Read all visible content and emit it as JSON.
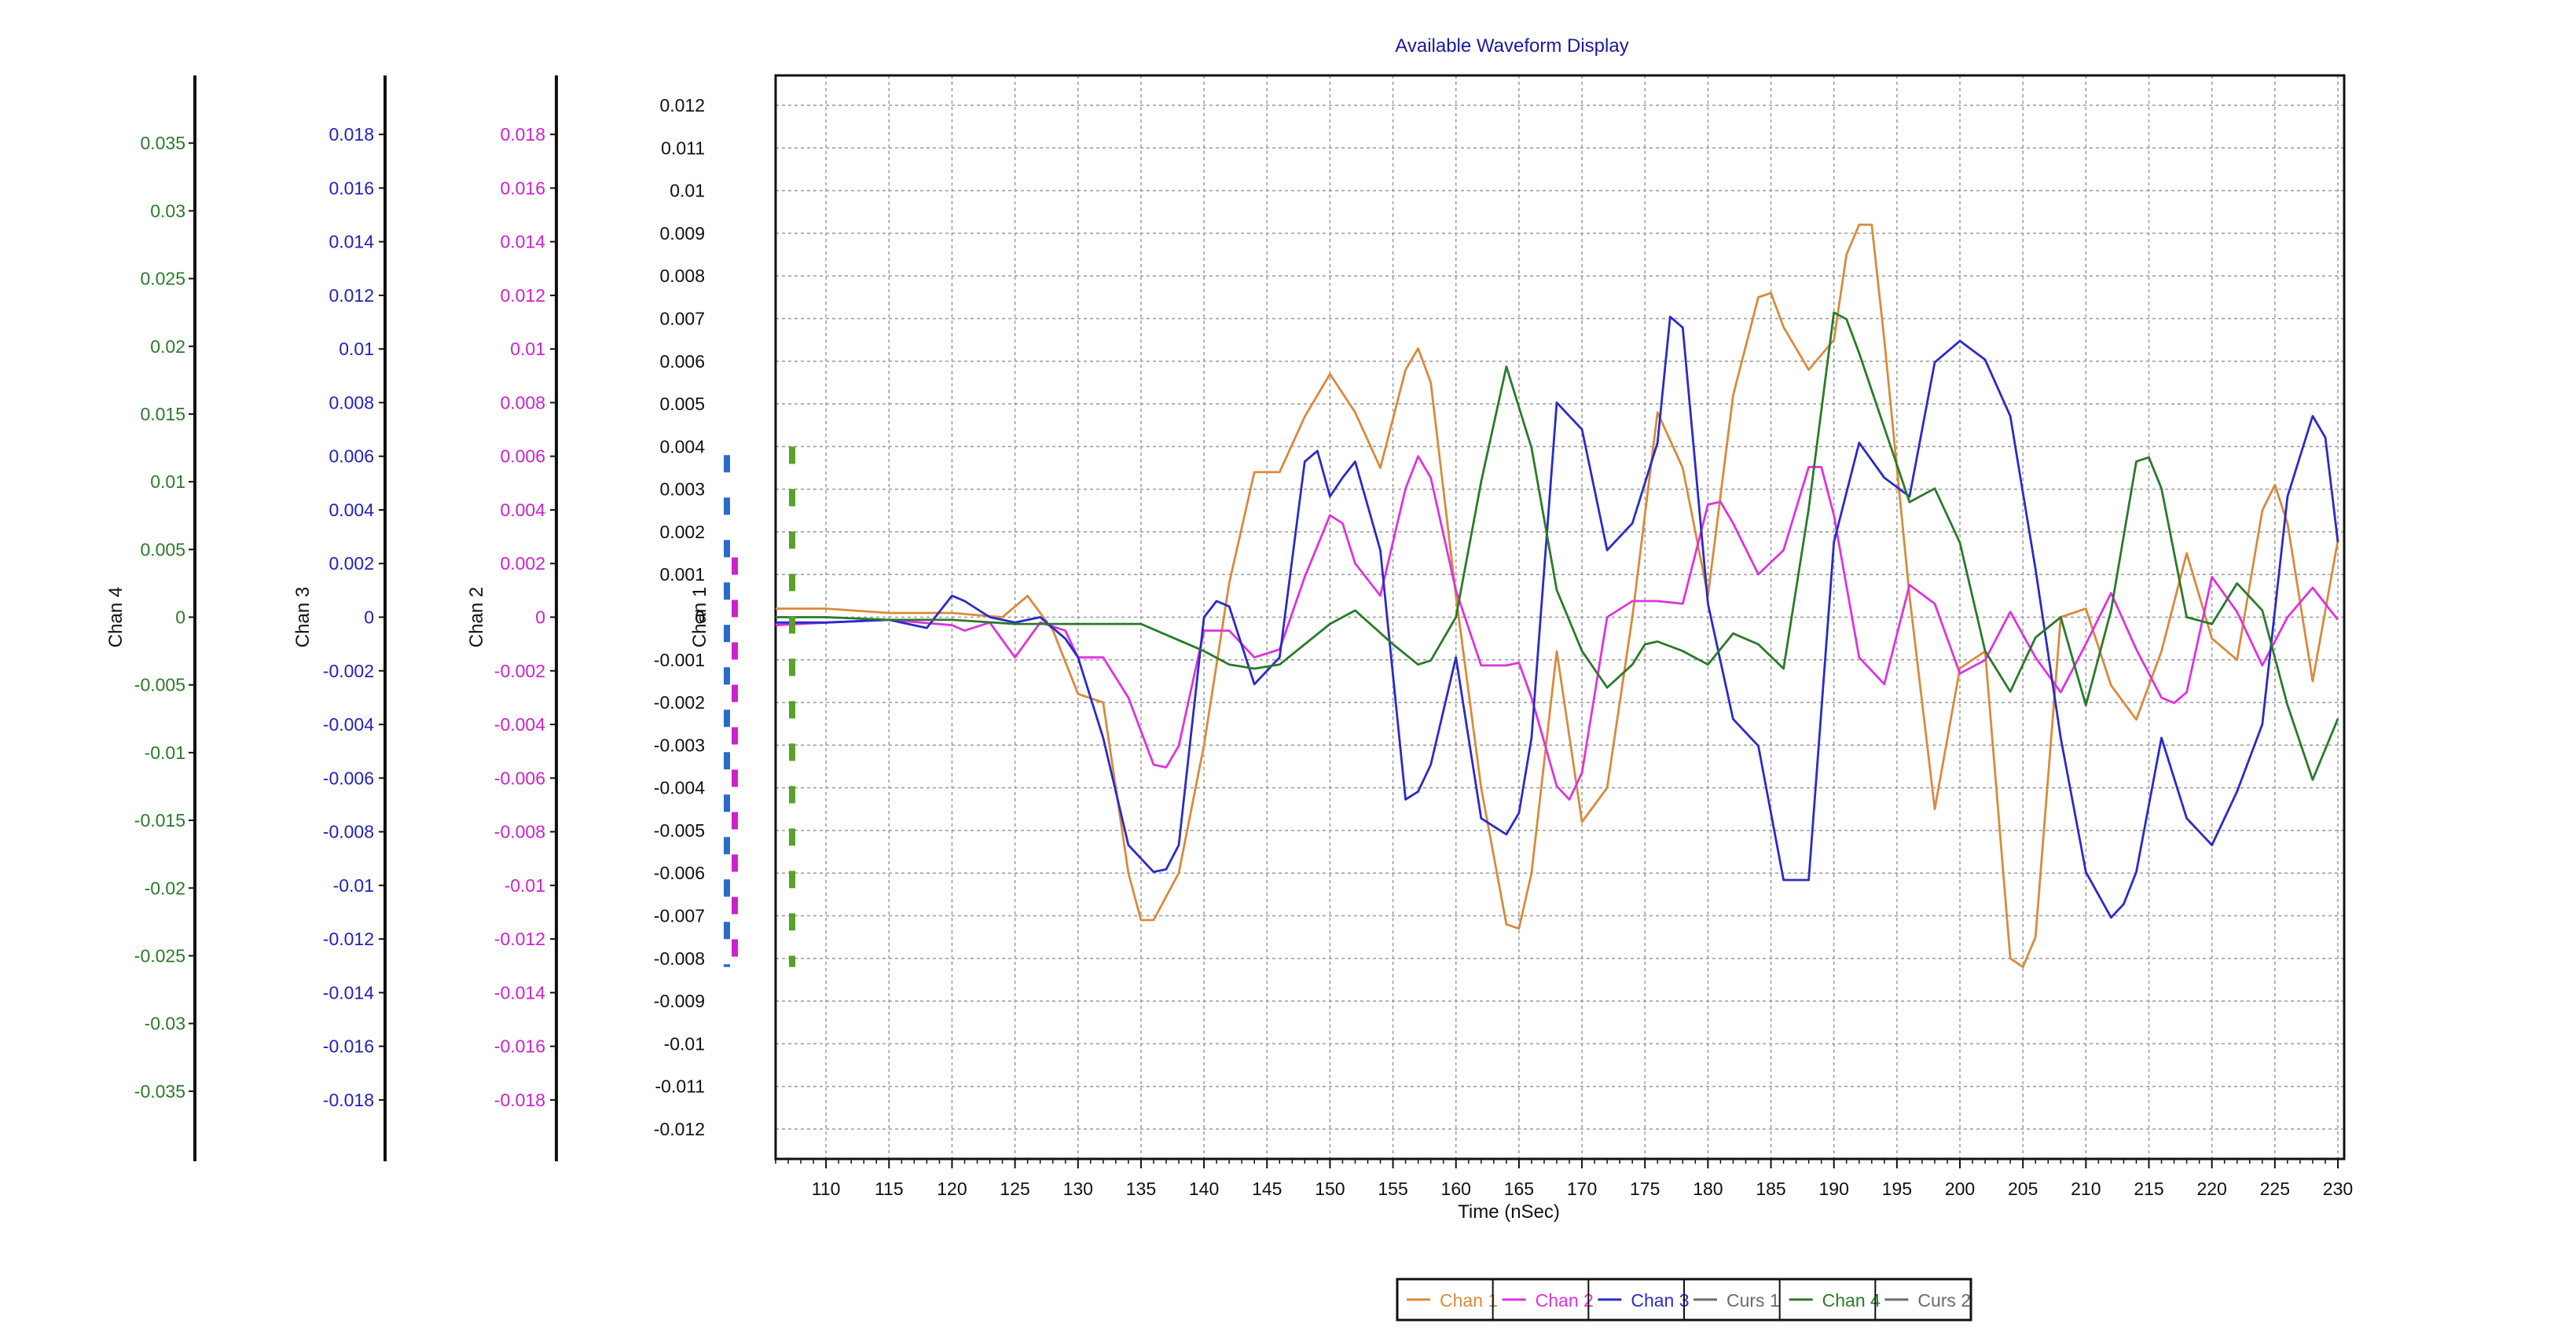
{
  "chart_data": {
    "type": "line",
    "title": "Available Waveform Display",
    "xlabel": "Time (nSec)",
    "xlim": [
      106,
      230.5
    ],
    "xticks": [
      110,
      115,
      120,
      125,
      130,
      135,
      140,
      145,
      150,
      155,
      160,
      165,
      170,
      175,
      180,
      185,
      190,
      195,
      200,
      205,
      210,
      215,
      220,
      225,
      230
    ],
    "xtick_labels": [
      "110",
      "115",
      "120",
      "125",
      "130",
      "135",
      "140",
      "145",
      "150",
      "155",
      "160",
      "165",
      "170",
      "175",
      "180",
      "185",
      "190",
      "195",
      "200",
      "205",
      "210",
      "215",
      "220",
      "225",
      "230"
    ],
    "grid": true,
    "legend_placement": "bottom-center",
    "y_axes": [
      {
        "id": "chan1",
        "label": "Chan 1",
        "color": "#111111",
        "ylim": [
          -0.0127,
          0.0127
        ],
        "ticks": [
          0.012,
          0.011,
          0.01,
          0.009,
          0.008,
          0.007,
          0.006,
          0.005,
          0.004,
          0.003,
          0.002,
          0.001,
          0,
          -0.001,
          -0.002,
          -0.003,
          -0.004,
          -0.005,
          -0.006,
          -0.007,
          -0.008,
          -0.009,
          -0.01,
          -0.011,
          -0.012
        ],
        "tick_labels": [
          "0.012",
          "0.011",
          "0.01",
          "0.009",
          "0.008",
          "0.007",
          "0.006",
          "0.005",
          "0.004",
          "0.003",
          "0.002",
          "0.001",
          "0",
          "-0.001",
          "-0.002",
          "-0.003",
          "-0.004",
          "-0.005",
          "-0.006",
          "-0.007",
          "-0.008",
          "-0.009",
          "-0.01",
          "-0.011",
          "-0.012"
        ]
      },
      {
        "id": "chan2",
        "label": "Chan 2",
        "color": "#cc22cc",
        "ylim": [
          -0.0202,
          0.0202
        ],
        "ticks": [
          0.018,
          0.016,
          0.014,
          0.012,
          0.01,
          0.008,
          0.006,
          0.004,
          0.002,
          0,
          -0.002,
          -0.004,
          -0.006,
          -0.008,
          -0.01,
          -0.012,
          -0.014,
          -0.016,
          -0.018
        ],
        "tick_labels": [
          "0.018",
          "0.016",
          "0.014",
          "0.012",
          "0.01",
          "0.008",
          "0.006",
          "0.004",
          "0.002",
          "0",
          "-0.002",
          "-0.004",
          "-0.006",
          "-0.008",
          "-0.01",
          "-0.012",
          "-0.014",
          "-0.016",
          "-0.018"
        ]
      },
      {
        "id": "chan3",
        "label": "Chan 3",
        "color": "#2222bb",
        "ylim": [
          -0.0202,
          0.0202
        ],
        "ticks": [
          0.018,
          0.016,
          0.014,
          0.012,
          0.01,
          0.008,
          0.006,
          0.004,
          0.002,
          0,
          -0.002,
          -0.004,
          -0.006,
          -0.008,
          -0.01,
          -0.012,
          -0.014,
          -0.016,
          -0.018
        ],
        "tick_labels": [
          "0.018",
          "0.016",
          "0.014",
          "0.012",
          "0.01",
          "0.008",
          "0.006",
          "0.004",
          "0.002",
          "0",
          "-0.002",
          "-0.004",
          "-0.006",
          "-0.008",
          "-0.01",
          "-0.012",
          "-0.014",
          "-0.016",
          "-0.018"
        ]
      },
      {
        "id": "chan4",
        "label": "Chan 4",
        "color": "#2a7a2a",
        "ylim": [
          -0.04,
          0.04
        ],
        "ticks": [
          0.035,
          0.03,
          0.025,
          0.02,
          0.015,
          0.01,
          0.005,
          0,
          -0.005,
          -0.01,
          -0.015,
          -0.02,
          -0.025,
          -0.03,
          -0.035
        ],
        "tick_labels": [
          "0.035",
          "0.03",
          "0.025",
          "0.02",
          "0.015",
          "0.01",
          "0.005",
          "0",
          "-0.005",
          "-0.01",
          "-0.015",
          "-0.02",
          "-0.025",
          "-0.03",
          "-0.035"
        ]
      }
    ],
    "series": [
      {
        "name": "Chan 1",
        "axis": "chan1",
        "color": "#d98a3c",
        "x": [
          106,
          110,
          115,
          120,
          124,
          126,
          128,
          130,
          132,
          134,
          135,
          136,
          138,
          140,
          142,
          144,
          146,
          148,
          150,
          152,
          154,
          156,
          157,
          158,
          160,
          162,
          164,
          165,
          166,
          168,
          170,
          172,
          174,
          176,
          178,
          180,
          182,
          184,
          185,
          186,
          188,
          190,
          191,
          192,
          193,
          194,
          196,
          198,
          200,
          202,
          204,
          205,
          206,
          208,
          210,
          212,
          214,
          216,
          218,
          220,
          222,
          224,
          225,
          226,
          228,
          230
        ],
        "y": [
          0.0002,
          0.0002,
          0.0001,
          0.0001,
          0.0,
          0.0005,
          -0.0003,
          -0.0018,
          -0.002,
          -0.006,
          -0.0071,
          -0.0071,
          -0.006,
          -0.003,
          0.0008,
          0.0034,
          0.0034,
          0.0047,
          0.0057,
          0.0048,
          0.0035,
          0.0058,
          0.0063,
          0.0055,
          0.0005,
          -0.004,
          -0.0072,
          -0.0073,
          -0.006,
          -0.0008,
          -0.0048,
          -0.004,
          0.0,
          0.0048,
          0.0035,
          0.0005,
          0.0052,
          0.0075,
          0.0076,
          0.0068,
          0.0058,
          0.0065,
          0.0085,
          0.0092,
          0.0092,
          0.0065,
          0.0005,
          -0.0045,
          -0.0012,
          -0.0008,
          -0.008,
          -0.0082,
          -0.0075,
          0.0,
          0.0002,
          -0.0016,
          -0.0024,
          -0.0008,
          0.0015,
          -0.0005,
          -0.001,
          0.0025,
          0.0031,
          0.0022,
          -0.0015,
          0.0018
        ]
      },
      {
        "name": "Chan 2",
        "axis": "chan2",
        "color": "#dd33dd",
        "x": [
          106,
          110,
          115,
          120,
          121,
          123,
          125,
          127,
          129,
          130,
          132,
          134,
          136,
          137,
          138,
          140,
          142,
          144,
          146,
          148,
          150,
          151,
          152,
          154,
          156,
          157,
          158,
          160,
          162,
          164,
          165,
          166,
          168,
          169,
          170,
          172,
          174,
          176,
          178,
          180,
          181,
          182,
          184,
          186,
          188,
          189,
          190,
          192,
          194,
          196,
          198,
          200,
          202,
          204,
          206,
          208,
          210,
          212,
          214,
          216,
          217,
          218,
          220,
          222,
          224,
          226,
          228,
          230
        ],
        "y": [
          -0.0003,
          -0.0002,
          -0.0001,
          -0.0003,
          -0.0005,
          -0.0002,
          -0.0015,
          -0.0002,
          -0.0005,
          -0.0015,
          -0.0015,
          -0.003,
          -0.0055,
          -0.0056,
          -0.0048,
          -0.0005,
          -0.0005,
          -0.0015,
          -0.0012,
          0.0015,
          0.0038,
          0.0035,
          0.002,
          0.0008,
          0.0048,
          0.006,
          0.0052,
          0.001,
          -0.0018,
          -0.0018,
          -0.0017,
          -0.003,
          -0.0063,
          -0.0068,
          -0.0058,
          0.0,
          0.0006,
          0.0006,
          0.0005,
          0.0042,
          0.0043,
          0.0035,
          0.0016,
          0.0025,
          0.0056,
          0.0056,
          0.0038,
          -0.0015,
          -0.0025,
          0.0012,
          0.0005,
          -0.0021,
          -0.0016,
          0.0002,
          -0.0015,
          -0.0028,
          -0.001,
          0.0009,
          -0.0012,
          -0.003,
          -0.0032,
          -0.0028,
          0.0015,
          0.0002,
          -0.0018,
          0.0,
          0.0011,
          -0.0001
        ]
      },
      {
        "name": "Chan 3",
        "axis": "chan3",
        "color": "#2a2acc",
        "x": [
          106,
          110,
          115,
          118,
          120,
          121,
          123,
          125,
          127,
          128,
          129,
          130,
          132,
          134,
          136,
          137,
          138,
          140,
          141,
          142,
          144,
          146,
          148,
          149,
          150,
          151,
          152,
          154,
          156,
          157,
          158,
          160,
          162,
          164,
          165,
          166,
          168,
          170,
          172,
          174,
          176,
          177,
          178,
          180,
          182,
          184,
          186,
          188,
          190,
          192,
          194,
          196,
          198,
          200,
          202,
          204,
          206,
          208,
          210,
          212,
          213,
          214,
          216,
          218,
          220,
          222,
          224,
          226,
          228,
          229,
          230
        ],
        "y": [
          -0.0002,
          -0.0002,
          -0.0001,
          -0.0004,
          0.0008,
          0.0006,
          0.0,
          -0.0002,
          0.0,
          -0.0004,
          -0.0008,
          -0.0015,
          -0.0045,
          -0.0085,
          -0.0095,
          -0.0094,
          -0.0085,
          0.0,
          0.0006,
          0.0004,
          -0.0025,
          -0.0015,
          0.0058,
          0.0062,
          0.0045,
          0.0052,
          0.0058,
          0.0025,
          -0.0068,
          -0.0065,
          -0.0055,
          -0.0015,
          -0.0075,
          -0.0081,
          -0.0073,
          -0.0045,
          0.008,
          0.007,
          0.0025,
          0.0035,
          0.0065,
          0.0112,
          0.0108,
          0.0005,
          -0.0038,
          -0.0048,
          -0.0098,
          -0.0098,
          0.0028,
          0.0065,
          0.0052,
          0.0045,
          0.0095,
          0.0103,
          0.0096,
          0.0075,
          0.0018,
          -0.0045,
          -0.0095,
          -0.0112,
          -0.0107,
          -0.0095,
          -0.0045,
          -0.0075,
          -0.0085,
          -0.0065,
          -0.004,
          0.0045,
          0.0075,
          0.0067,
          0.0028
        ]
      },
      {
        "name": "Curs 1",
        "axis": "chan1",
        "color": "#6b6b6b",
        "x": [],
        "y": []
      },
      {
        "name": "Chan 4",
        "axis": "chan4",
        "color": "#2a7a2a",
        "x": [
          106,
          110,
          115,
          120,
          125,
          130,
          135,
          140,
          142,
          144,
          146,
          148,
          150,
          152,
          155,
          157,
          158,
          160,
          162,
          164,
          166,
          168,
          170,
          172,
          174,
          175,
          176,
          178,
          180,
          182,
          184,
          186,
          188,
          190,
          191,
          192,
          194,
          196,
          198,
          200,
          202,
          204,
          206,
          208,
          210,
          212,
          214,
          215,
          216,
          218,
          220,
          222,
          224,
          226,
          228,
          230
        ],
        "y": [
          0.0,
          0.0,
          -0.0002,
          -0.0002,
          -0.0005,
          -0.0005,
          -0.0005,
          -0.0025,
          -0.0035,
          -0.0038,
          -0.0035,
          -0.002,
          -0.0005,
          0.0005,
          -0.002,
          -0.0035,
          -0.0032,
          0.0,
          0.01,
          0.0185,
          0.0125,
          0.002,
          -0.0025,
          -0.0052,
          -0.0035,
          -0.002,
          -0.0018,
          -0.0025,
          -0.0035,
          -0.0012,
          -0.002,
          -0.0038,
          0.008,
          0.0225,
          0.022,
          0.0195,
          0.014,
          0.0085,
          0.0095,
          0.0055,
          -0.0025,
          -0.0055,
          -0.0015,
          0.0,
          -0.0065,
          0.0005,
          0.0115,
          0.0118,
          0.0095,
          0.0,
          -0.0005,
          0.0025,
          0.0005,
          -0.0065,
          -0.012,
          -0.0075
        ]
      },
      {
        "name": "Curs 2",
        "axis": "chan1",
        "color": "#6b6b6b",
        "x": [],
        "y": []
      }
    ]
  }
}
